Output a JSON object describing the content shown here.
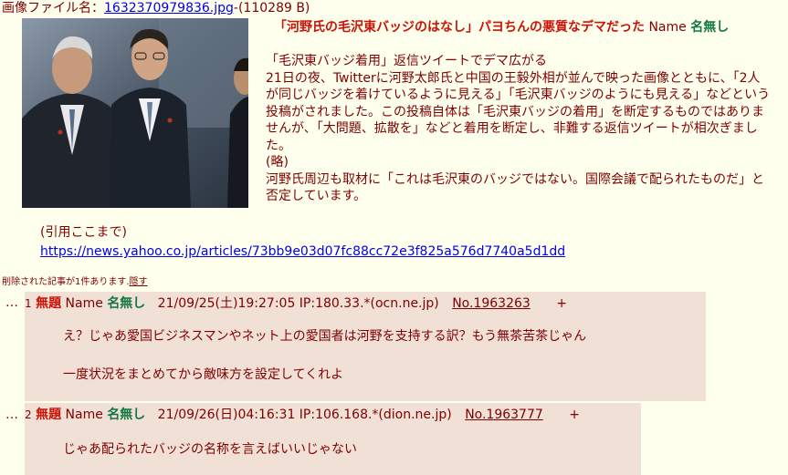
{
  "file": {
    "label": "画像ファイル名：",
    "filename": "1632370979836.jpg",
    "size": "-(110289 B)"
  },
  "op": {
    "subject": "「河野氏の毛沢東バッジのはなし」パヨちんの悪質なデマだった",
    "name_label": "Name",
    "name": "名無し",
    "body": [
      "「毛沢東バッジ着用」返信ツイートでデマ広がる",
      "21日の夜、Twitterに河野太郎氏と中国の王毅外相が並んで映った画像とともに、「2人が同じバッジを着けているように見える」「毛沢東バッジのようにも見える」などという投稿がされました。この投稿自体は「毛沢東バッジの着用」を断定するものではありませんが、「大問題、拡散を」などと着用を断定し、非難する返信ツイートが相次ぎました。",
      "(略)",
      "河野氏周辺も取材に「これは毛沢東のバッジではない。国際会議で配られたものだ」と否定しています。"
    ],
    "quote_end": "(引用ここまで)",
    "link": "https://news.yahoo.co.jp/articles/73bb9e03d07fc88cc72e3f825a576d7740a5d1dd"
  },
  "deleted_notice": {
    "text": "削除された記事が1件あります.",
    "hide": "隠す"
  },
  "replies": [
    {
      "dots": "…",
      "num": "1",
      "subject": "無題",
      "name_label": "Name",
      "name": "名無し",
      "datetime": "21/09/25(土)19:27:05 IP:180.33.*(ocn.ne.jp)",
      "no": "No.1963263",
      "plus": "+",
      "lines": [
        "え？じゃあ愛国ビジネスマンやネット上の愛国者は河野を支持する訳？もう無茶苦茶じゃん",
        "一度状況をまとめてから敵味方を設定してくれよ"
      ]
    },
    {
      "dots": "…",
      "num": "2",
      "subject": "無題",
      "name_label": "Name",
      "name": "名無し",
      "datetime": "21/09/26(日)04:16:31 IP:106.168.*(dion.ne.jp)",
      "no": "No.1963777",
      "plus": "+",
      "lines": [
        "じゃあ配られたバッジの名称を言えばいいじゃない"
      ]
    }
  ]
}
